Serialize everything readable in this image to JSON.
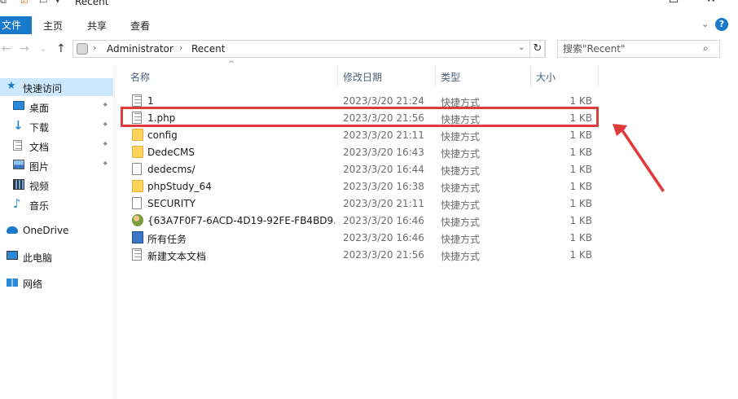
{
  "window": {
    "title": "Recent",
    "controls": {
      "minimize": "—",
      "maximize": "☐",
      "close": "✕"
    }
  },
  "ribbon": {
    "tabs": [
      "文件",
      "主页",
      "共享",
      "查看"
    ],
    "collapse_chevron": "⌄",
    "help": "?"
  },
  "address": {
    "crumbs": [
      "Administrator",
      "Recent"
    ],
    "separator": "›",
    "dropdown": "⌄",
    "refresh": "↻",
    "search_placeholder": "搜索\"Recent\"",
    "search_icon": "⌕"
  },
  "nav_buttons": {
    "back": "←",
    "forward": "→",
    "history": "⌄",
    "up": "↑"
  },
  "nav_pane": {
    "items": [
      {
        "label": "快速访问",
        "icon": "star-icon",
        "color": "#1979ca",
        "pinned": false,
        "selected": true
      },
      {
        "label": "桌面",
        "icon": "desktop-icon",
        "color": "#2a8ad8",
        "pinned": true
      },
      {
        "label": "下载",
        "icon": "download-icon",
        "color": "#2a8ad8",
        "pinned": true
      },
      {
        "label": "文档",
        "icon": "documents-icon",
        "color": "#9aa6b2",
        "pinned": true
      },
      {
        "label": "图片",
        "icon": "pictures-icon",
        "color": "#3a78c5",
        "pinned": true
      },
      {
        "label": "视频",
        "icon": "videos-icon",
        "color": "#555555",
        "pinned": false
      },
      {
        "label": "音乐",
        "icon": "music-icon",
        "color": "#2a8ad8",
        "pinned": false
      },
      {
        "label": "OneDrive",
        "icon": "cloud-icon",
        "color": "#1979ca",
        "pinned": false
      },
      {
        "label": "此电脑",
        "icon": "computer-icon",
        "color": "#2a8ad8",
        "pinned": false
      },
      {
        "label": "网络",
        "icon": "network-icon",
        "color": "#2a8ad8",
        "pinned": false
      }
    ],
    "pin_glyph": "📌"
  },
  "columns": {
    "name": "名称",
    "date": "修改日期",
    "type": "类型",
    "size": "大小",
    "sort_caret": "^"
  },
  "files": [
    {
      "name": "1",
      "date": "2023/3/20 21:24",
      "type": "快捷方式",
      "size": "1 KB",
      "icon": "document-icon"
    },
    {
      "name": "1.php",
      "date": "2023/3/20 21:56",
      "type": "快捷方式",
      "size": "1 KB",
      "icon": "document-icon",
      "highlighted": true
    },
    {
      "name": "config",
      "date": "2023/3/20 21:11",
      "type": "快捷方式",
      "size": "1 KB",
      "icon": "folder-icon"
    },
    {
      "name": "DedeCMS",
      "date": "2023/3/20 16:43",
      "type": "快捷方式",
      "size": "1 KB",
      "icon": "folder-icon"
    },
    {
      "name": "dedecms/",
      "date": "2023/3/20 16:44",
      "type": "快捷方式",
      "size": "1 KB",
      "icon": "blank-file-icon"
    },
    {
      "name": "phpStudy_64",
      "date": "2023/3/20 16:38",
      "type": "快捷方式",
      "size": "1 KB",
      "icon": "folder-icon"
    },
    {
      "name": "SECURITY",
      "date": "2023/3/20 21:11",
      "type": "快捷方式",
      "size": "1 KB",
      "icon": "blank-file-icon"
    },
    {
      "name": "{63A7F0F7-6ACD-4D19-92FE-FB4BD9...",
      "date": "2023/3/20 16:46",
      "type": "快捷方式",
      "size": "1 KB",
      "icon": "user-group-icon"
    },
    {
      "name": "所有任务",
      "date": "2023/3/20 16:46",
      "type": "快捷方式",
      "size": "1 KB",
      "icon": "control-panel-icon"
    },
    {
      "name": "新建文本文档",
      "date": "2023/3/20 21:56",
      "type": "快捷方式",
      "size": "1 KB",
      "icon": "document-icon"
    }
  ],
  "annotation": {
    "color": "#e03b3b"
  }
}
